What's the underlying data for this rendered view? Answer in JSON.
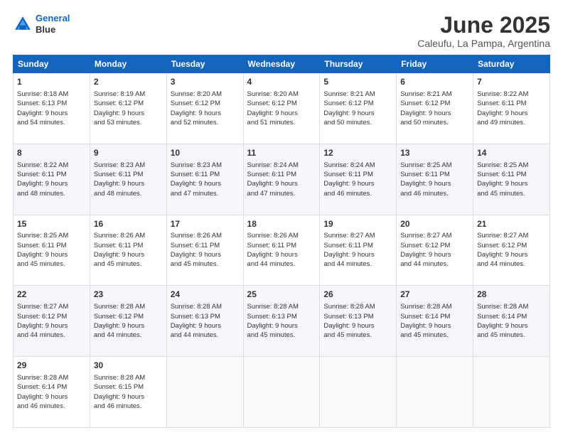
{
  "header": {
    "logo_line1": "General",
    "logo_line2": "Blue",
    "month": "June 2025",
    "location": "Caleufu, La Pampa, Argentina"
  },
  "weekdays": [
    "Sunday",
    "Monday",
    "Tuesday",
    "Wednesday",
    "Thursday",
    "Friday",
    "Saturday"
  ],
  "weeks": [
    [
      {
        "day": "1",
        "lines": [
          "Sunrise: 8:18 AM",
          "Sunset: 6:13 PM",
          "Daylight: 9 hours",
          "and 54 minutes."
        ]
      },
      {
        "day": "2",
        "lines": [
          "Sunrise: 8:19 AM",
          "Sunset: 6:12 PM",
          "Daylight: 9 hours",
          "and 53 minutes."
        ]
      },
      {
        "day": "3",
        "lines": [
          "Sunrise: 8:20 AM",
          "Sunset: 6:12 PM",
          "Daylight: 9 hours",
          "and 52 minutes."
        ]
      },
      {
        "day": "4",
        "lines": [
          "Sunrise: 8:20 AM",
          "Sunset: 6:12 PM",
          "Daylight: 9 hours",
          "and 51 minutes."
        ]
      },
      {
        "day": "5",
        "lines": [
          "Sunrise: 8:21 AM",
          "Sunset: 6:12 PM",
          "Daylight: 9 hours",
          "and 50 minutes."
        ]
      },
      {
        "day": "6",
        "lines": [
          "Sunrise: 8:21 AM",
          "Sunset: 6:12 PM",
          "Daylight: 9 hours",
          "and 50 minutes."
        ]
      },
      {
        "day": "7",
        "lines": [
          "Sunrise: 8:22 AM",
          "Sunset: 6:11 PM",
          "Daylight: 9 hours",
          "and 49 minutes."
        ]
      }
    ],
    [
      {
        "day": "8",
        "lines": [
          "Sunrise: 8:22 AM",
          "Sunset: 6:11 PM",
          "Daylight: 9 hours",
          "and 48 minutes."
        ]
      },
      {
        "day": "9",
        "lines": [
          "Sunrise: 8:23 AM",
          "Sunset: 6:11 PM",
          "Daylight: 9 hours",
          "and 48 minutes."
        ]
      },
      {
        "day": "10",
        "lines": [
          "Sunrise: 8:23 AM",
          "Sunset: 6:11 PM",
          "Daylight: 9 hours",
          "and 47 minutes."
        ]
      },
      {
        "day": "11",
        "lines": [
          "Sunrise: 8:24 AM",
          "Sunset: 6:11 PM",
          "Daylight: 9 hours",
          "and 47 minutes."
        ]
      },
      {
        "day": "12",
        "lines": [
          "Sunrise: 8:24 AM",
          "Sunset: 6:11 PM",
          "Daylight: 9 hours",
          "and 46 minutes."
        ]
      },
      {
        "day": "13",
        "lines": [
          "Sunrise: 8:25 AM",
          "Sunset: 6:11 PM",
          "Daylight: 9 hours",
          "and 46 minutes."
        ]
      },
      {
        "day": "14",
        "lines": [
          "Sunrise: 8:25 AM",
          "Sunset: 6:11 PM",
          "Daylight: 9 hours",
          "and 45 minutes."
        ]
      }
    ],
    [
      {
        "day": "15",
        "lines": [
          "Sunrise: 8:25 AM",
          "Sunset: 6:11 PM",
          "Daylight: 9 hours",
          "and 45 minutes."
        ]
      },
      {
        "day": "16",
        "lines": [
          "Sunrise: 8:26 AM",
          "Sunset: 6:11 PM",
          "Daylight: 9 hours",
          "and 45 minutes."
        ]
      },
      {
        "day": "17",
        "lines": [
          "Sunrise: 8:26 AM",
          "Sunset: 6:11 PM",
          "Daylight: 9 hours",
          "and 45 minutes."
        ]
      },
      {
        "day": "18",
        "lines": [
          "Sunrise: 8:26 AM",
          "Sunset: 6:11 PM",
          "Daylight: 9 hours",
          "and 44 minutes."
        ]
      },
      {
        "day": "19",
        "lines": [
          "Sunrise: 8:27 AM",
          "Sunset: 6:11 PM",
          "Daylight: 9 hours",
          "and 44 minutes."
        ]
      },
      {
        "day": "20",
        "lines": [
          "Sunrise: 8:27 AM",
          "Sunset: 6:12 PM",
          "Daylight: 9 hours",
          "and 44 minutes."
        ]
      },
      {
        "day": "21",
        "lines": [
          "Sunrise: 8:27 AM",
          "Sunset: 6:12 PM",
          "Daylight: 9 hours",
          "and 44 minutes."
        ]
      }
    ],
    [
      {
        "day": "22",
        "lines": [
          "Sunrise: 8:27 AM",
          "Sunset: 6:12 PM",
          "Daylight: 9 hours",
          "and 44 minutes."
        ]
      },
      {
        "day": "23",
        "lines": [
          "Sunrise: 8:28 AM",
          "Sunset: 6:12 PM",
          "Daylight: 9 hours",
          "and 44 minutes."
        ]
      },
      {
        "day": "24",
        "lines": [
          "Sunrise: 8:28 AM",
          "Sunset: 6:13 PM",
          "Daylight: 9 hours",
          "and 44 minutes."
        ]
      },
      {
        "day": "25",
        "lines": [
          "Sunrise: 8:28 AM",
          "Sunset: 6:13 PM",
          "Daylight: 9 hours",
          "and 45 minutes."
        ]
      },
      {
        "day": "26",
        "lines": [
          "Sunrise: 8:28 AM",
          "Sunset: 6:13 PM",
          "Daylight: 9 hours",
          "and 45 minutes."
        ]
      },
      {
        "day": "27",
        "lines": [
          "Sunrise: 8:28 AM",
          "Sunset: 6:14 PM",
          "Daylight: 9 hours",
          "and 45 minutes."
        ]
      },
      {
        "day": "28",
        "lines": [
          "Sunrise: 8:28 AM",
          "Sunset: 6:14 PM",
          "Daylight: 9 hours",
          "and 45 minutes."
        ]
      }
    ],
    [
      {
        "day": "29",
        "lines": [
          "Sunrise: 8:28 AM",
          "Sunset: 6:14 PM",
          "Daylight: 9 hours",
          "and 46 minutes."
        ]
      },
      {
        "day": "30",
        "lines": [
          "Sunrise: 8:28 AM",
          "Sunset: 6:15 PM",
          "Daylight: 9 hours",
          "and 46 minutes."
        ]
      },
      {
        "day": "",
        "lines": []
      },
      {
        "day": "",
        "lines": []
      },
      {
        "day": "",
        "lines": []
      },
      {
        "day": "",
        "lines": []
      },
      {
        "day": "",
        "lines": []
      }
    ]
  ]
}
